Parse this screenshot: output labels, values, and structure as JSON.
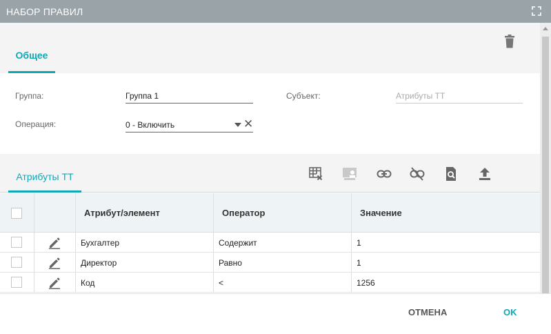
{
  "window": {
    "title": "НАБОР ПРАВИЛ"
  },
  "tabs": {
    "general": "Общее",
    "attributes": "Атрибуты ТТ"
  },
  "form": {
    "group_label": "Группа:",
    "group_value": "Группа 1",
    "subject_label": "Субъект:",
    "subject_placeholder": "Атрибуты ТТ",
    "operation_label": "Операция:",
    "operation_value": "0 - Включить"
  },
  "toolbar_icons": [
    "table-clear-icon",
    "user-card-icon",
    "link-icon",
    "unlink-icon",
    "document-search-icon",
    "upload-icon"
  ],
  "table": {
    "headers": {
      "attribute": "Атрибут/элемент",
      "operator": "Оператор",
      "value": "Значение"
    },
    "rows": [
      {
        "attribute": "Бухгалтер",
        "operator": "Содержит",
        "value": "1"
      },
      {
        "attribute": "Директор",
        "operator": "Равно",
        "value": "1"
      },
      {
        "attribute": "Код",
        "operator": "<",
        "value": "1256"
      }
    ]
  },
  "footer": {
    "cancel": "ОТМЕНА",
    "ok": "OK"
  },
  "colors": {
    "accent": "#0fa8b5",
    "titlebar": "#9aa3a8",
    "panel": "#f4f4f4"
  }
}
